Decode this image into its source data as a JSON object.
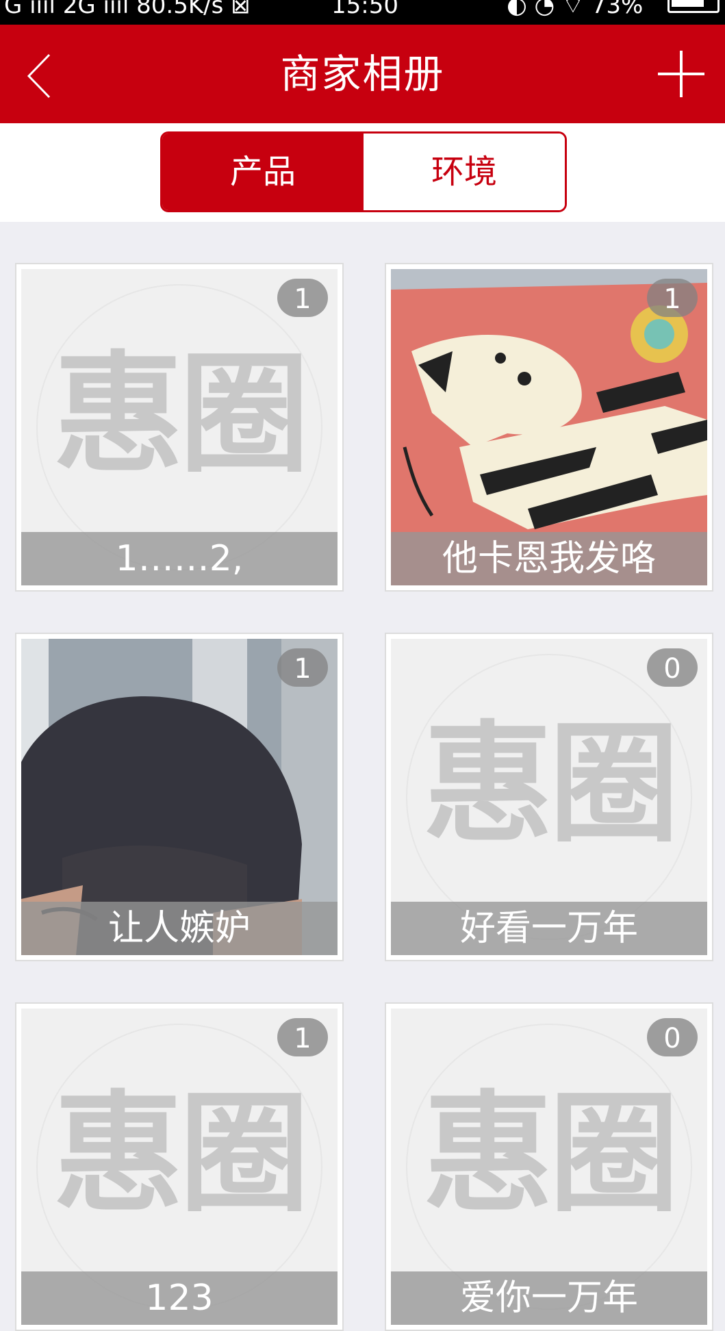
{
  "status_bar": {
    "left_text": "G ıııl   2G ıııl  80.5K/s ⊠",
    "time": "15:50",
    "right_text": "◐  ◔  ⌔ 73%",
    "battery_percent": 73
  },
  "header": {
    "title": "商家相册",
    "back_icon": "chevron-left-icon",
    "add_icon": "plus-icon",
    "background_color": "#c7000f"
  },
  "tabs": [
    {
      "label": "产品",
      "active": true
    },
    {
      "label": "环境",
      "active": false
    }
  ],
  "watermark_text": "惠圈",
  "albums": [
    {
      "caption": "1……2,",
      "count": "1",
      "cover": "placeholder"
    },
    {
      "caption": "他卡恩我发咯",
      "count": "1",
      "cover": "zebra-pillow-photo"
    },
    {
      "caption": "让人嫉妒",
      "count": "1",
      "cover": "person-hair-photo"
    },
    {
      "caption": "好看一万年",
      "count": "0",
      "cover": "placeholder"
    },
    {
      "caption": "123",
      "count": "1",
      "cover": "placeholder"
    },
    {
      "caption": "爱你一万年",
      "count": "0",
      "cover": "placeholder"
    }
  ]
}
